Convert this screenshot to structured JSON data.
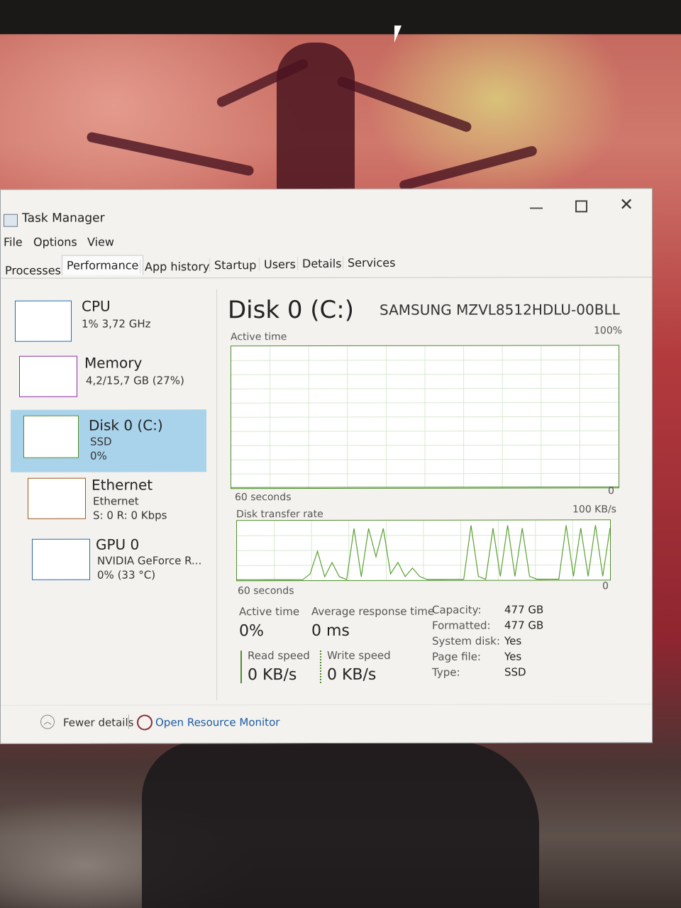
{
  "window": {
    "title": "Task Manager",
    "controls": {
      "minimize": "—",
      "maximize": "□",
      "close": "✕"
    }
  },
  "menu": [
    "File",
    "Options",
    "View"
  ],
  "tabs": [
    "Processes",
    "Performance",
    "App history",
    "Startup",
    "Users",
    "Details",
    "Services"
  ],
  "resources": [
    {
      "title": "CPU",
      "line1": "1% 3,72 GHz",
      "line2": ""
    },
    {
      "title": "Memory",
      "line1": "4,2/15,7 GB (27%)",
      "line2": ""
    },
    {
      "title": "Disk 0 (C:)",
      "line1": "SSD",
      "line2": "0%"
    },
    {
      "title": "Ethernet",
      "line1": "Ethernet",
      "line2": "S: 0 R: 0 Kbps"
    },
    {
      "title": "GPU 0",
      "line1": "NVIDIA GeForce R...",
      "line2": "0% (33 °C)"
    }
  ],
  "detail": {
    "title": "Disk 0 (C:)",
    "model": "SAMSUNG MZVL8512HDLU-00BLL",
    "active_graph": {
      "label": "Active time",
      "max": "100%",
      "min": "0",
      "span": "60 seconds"
    },
    "rate_graph": {
      "label": "Disk transfer rate",
      "max": "100 KB/s",
      "min": "0",
      "span": "60 seconds",
      "levels": [
        0,
        0,
        0,
        0,
        0,
        0,
        0,
        0,
        0,
        0,
        0.1,
        0.5,
        0.05,
        0.3,
        0.05,
        0,
        0.9,
        0.05,
        0.9,
        0.4,
        0.9,
        0.1,
        0.3,
        0.05,
        0.2,
        0.05,
        0,
        0,
        0,
        0,
        0,
        0,
        0.95,
        0.05,
        0,
        0.9,
        0.05,
        0.95,
        0.05,
        0.9,
        0.05,
        0,
        0,
        0,
        0,
        0.95,
        0.05,
        0.9,
        0.05,
        0.95,
        0.05,
        0.9
      ]
    },
    "stats": {
      "active_time_label": "Active time",
      "active_time": "0%",
      "resp_label": "Average response time",
      "resp": "0 ms",
      "read_label": "Read speed",
      "read": "0 KB/s",
      "write_label": "Write speed",
      "write": "0 KB/s"
    },
    "props": [
      {
        "k": "Capacity:",
        "v": "477 GB"
      },
      {
        "k": "Formatted:",
        "v": "477 GB"
      },
      {
        "k": "System disk:",
        "v": "Yes"
      },
      {
        "k": "Page file:",
        "v": "Yes"
      },
      {
        "k": "Type:",
        "v": "SSD"
      }
    ]
  },
  "footer": {
    "fewer": "Fewer details",
    "resmon": "Open Resource Monitor"
  }
}
